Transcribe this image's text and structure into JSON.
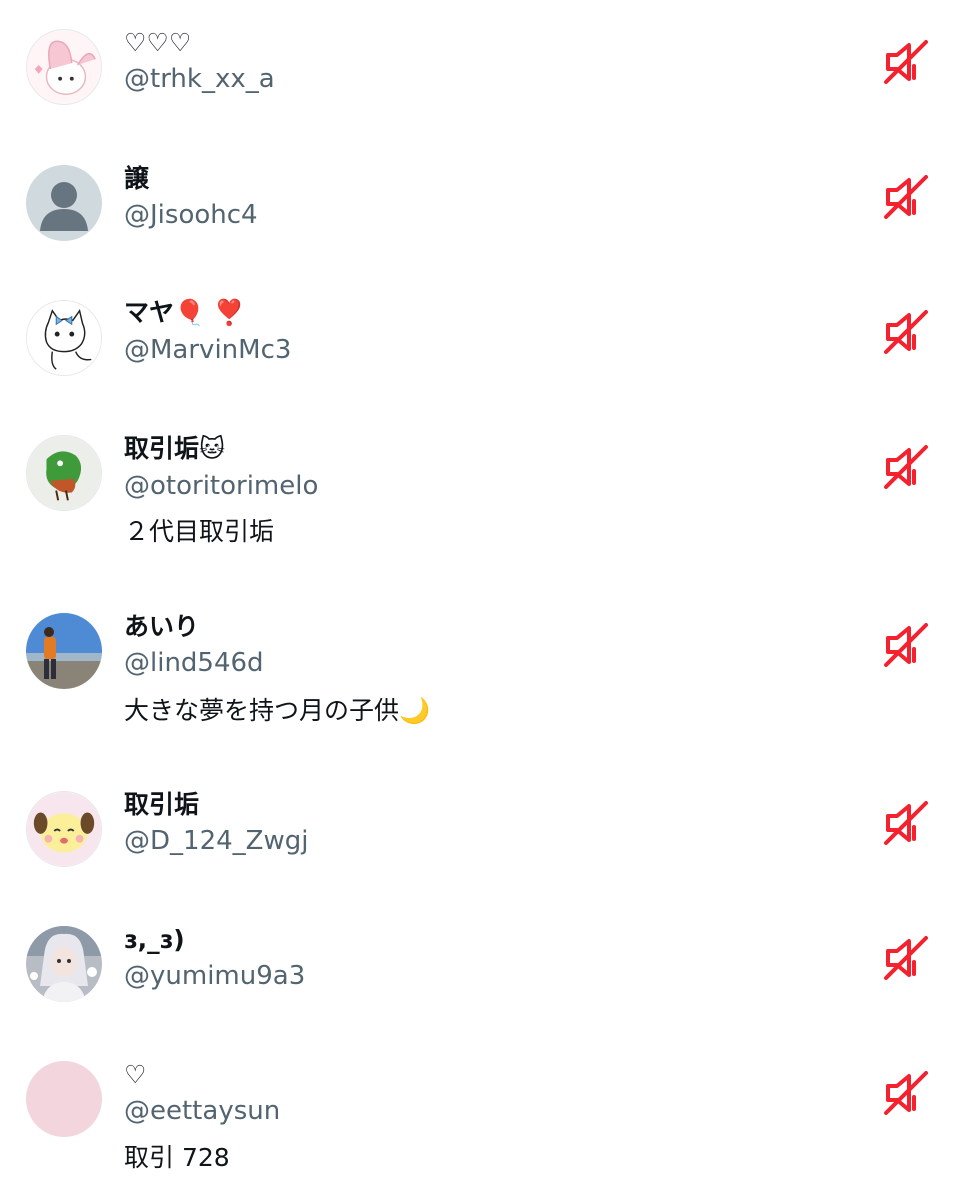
{
  "colors": {
    "accent_mute": "#f4212e",
    "handle_gray": "#536471",
    "text": "#0f1419"
  },
  "users": [
    {
      "name": "♡♡♡",
      "handle": "@trhk_xx_a",
      "bio": "",
      "avatar": "pink-bunny-character",
      "action_icon": "muted-speaker-icon"
    },
    {
      "name": "譲",
      "handle": "@Jisoohc4",
      "bio": "",
      "avatar": "default-person-silhouette",
      "action_icon": "muted-speaker-icon"
    },
    {
      "name": "マヤ🎈 ❣️",
      "handle": "@MarvinMc3",
      "bio": "",
      "avatar": "white-cat-sketch",
      "action_icon": "muted-speaker-icon"
    },
    {
      "name": "取引垢🐱",
      "handle": "@otoritorimelo",
      "bio": "２代目取引垢",
      "avatar": "green-dragon-character",
      "action_icon": "muted-speaker-icon"
    },
    {
      "name": "あいり",
      "handle": "@lind546d",
      "bio": "大きな夢を持つ月の子供🌙",
      "avatar": "person-on-beach-photo",
      "action_icon": "muted-speaker-icon"
    },
    {
      "name": "取引垢",
      "handle": "@D_124_Zwgj",
      "bio": "",
      "avatar": "yellow-sheep-character",
      "action_icon": "muted-speaker-icon"
    },
    {
      "name": "ɜ,_ɜ)",
      "handle": "@yumimu9a3",
      "bio": "",
      "avatar": "doll-photo",
      "action_icon": "muted-speaker-icon"
    },
    {
      "name": "♡",
      "handle": "@eettaysun",
      "bio": "取引 728",
      "avatar": "plain-pink-circle",
      "action_icon": "muted-speaker-icon"
    }
  ]
}
